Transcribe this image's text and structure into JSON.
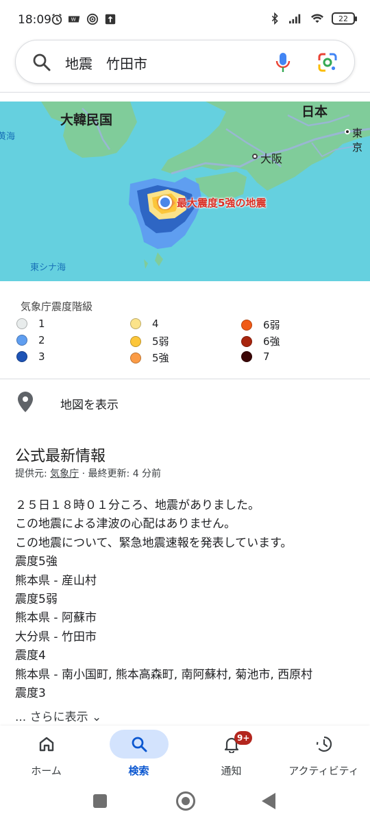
{
  "status_bar": {
    "time": "18:09",
    "battery": "22"
  },
  "search": {
    "query": "地震　竹田市"
  },
  "map": {
    "labels": {
      "korea": "大韓民国",
      "japan": "日本",
      "tokyo": "東京",
      "osaka": "大阪",
      "yellow_sea": "黄海",
      "east_china_sea": "東シナ海",
      "epicenter": "最大震度5強の地震"
    },
    "colors": {
      "sea": "#65d0df",
      "land": "#80cc9a",
      "road": "#9fb1e0"
    }
  },
  "legend": {
    "title": "気象庁震度階級",
    "items": [
      {
        "label": "1",
        "color": "#e8ecec"
      },
      {
        "label": "2",
        "color": "#5f9ef0"
      },
      {
        "label": "3",
        "color": "#1d53b5"
      },
      {
        "label": "4",
        "color": "#fbe38a"
      },
      {
        "label": "5弱",
        "color": "#fcc63a"
      },
      {
        "label": "5強",
        "color": "#fb9b45"
      },
      {
        "label": "6弱",
        "color": "#f05a16"
      },
      {
        "label": "6強",
        "color": "#a8250e"
      },
      {
        "label": "7",
        "color": "#3b0606"
      }
    ]
  },
  "show_map": {
    "label": "地図を表示"
  },
  "info": {
    "title": "公式最新情報",
    "source_prefix": "提供元: ",
    "source_name": "気象庁",
    "source_suffix": " · 最終更新: 4 分前",
    "lines": [
      "２５日１８時０１分ころ、地震がありました。",
      "この地震による津波の心配はありません。",
      "この地震について、緊急地震速報を発表しています。",
      "震度5強",
      "熊本県 - 産山村",
      "震度5弱",
      "熊本県 - 阿蘇市",
      "大分県 - 竹田市",
      "震度4",
      "熊本県 - 南小国町, 熊本高森町, 南阿蘇村, 菊池市, 西原村",
      "震度3"
    ],
    "more": "... さらに表示 ⌄"
  },
  "bottom_nav": {
    "items": [
      {
        "label": "ホーム",
        "icon": "home-icon"
      },
      {
        "label": "検索",
        "icon": "search-icon",
        "active": true
      },
      {
        "label": "通知",
        "icon": "bell-icon",
        "badge": "9+"
      },
      {
        "label": "アクティビティ",
        "icon": "activity-icon"
      }
    ]
  }
}
